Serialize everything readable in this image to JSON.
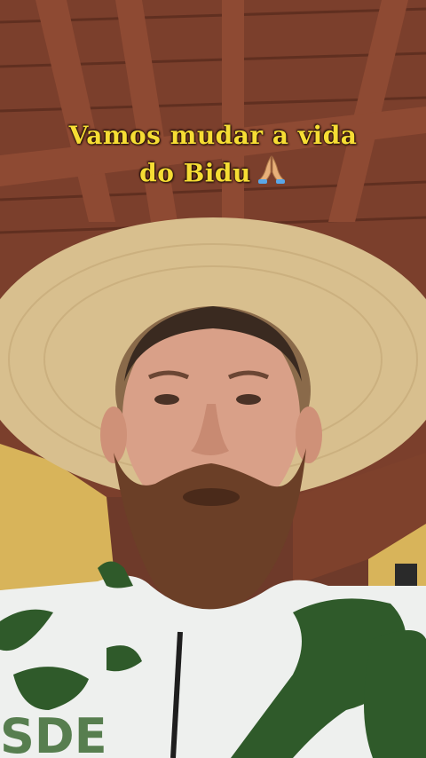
{
  "video": {
    "caption_line1": "Vamos mudar a vida",
    "caption_line2": "do Bidu",
    "caption_emoji": "folded-hands-icon"
  },
  "colors": {
    "caption_text": "#f6dd34",
    "ceiling_wood": "#7b3f2c",
    "hat_straw": "#d8bf8e",
    "jacket_green": "#2f5a2a",
    "wall_yellow": "#d8b45a"
  }
}
